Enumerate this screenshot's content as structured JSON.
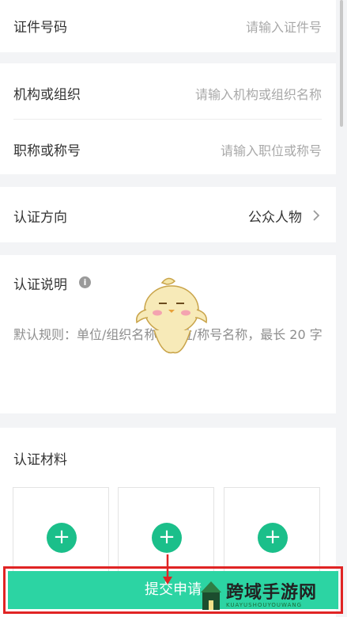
{
  "id_number": {
    "label": "证件号码",
    "placeholder": "请输入证件号"
  },
  "organization": {
    "label": "机构或组织",
    "placeholder": "请输入机构或组织名称"
  },
  "job_title": {
    "label": "职称或称号",
    "placeholder": "请输入职位或称号"
  },
  "direction": {
    "label": "认证方向",
    "value": "公众人物",
    "chevron_icon": "chevron-right-icon"
  },
  "description": {
    "label": "认证说明",
    "info_icon": "i",
    "text": "默认规则：单位/组织名称+职位/称号名称，最长 20 字"
  },
  "materials": {
    "label": "认证材料",
    "upload_icon": "+",
    "boxes": [
      "+",
      "+",
      "+"
    ]
  },
  "submit": {
    "label": "提交申请"
  },
  "watermark": {
    "title": "跨域手游网",
    "subtitle": "KUAYUSHOUYOUWANG"
  },
  "colors": {
    "accent": "#2cd4a3",
    "plus": "#1bbf8a",
    "highlight": "#e02424"
  }
}
